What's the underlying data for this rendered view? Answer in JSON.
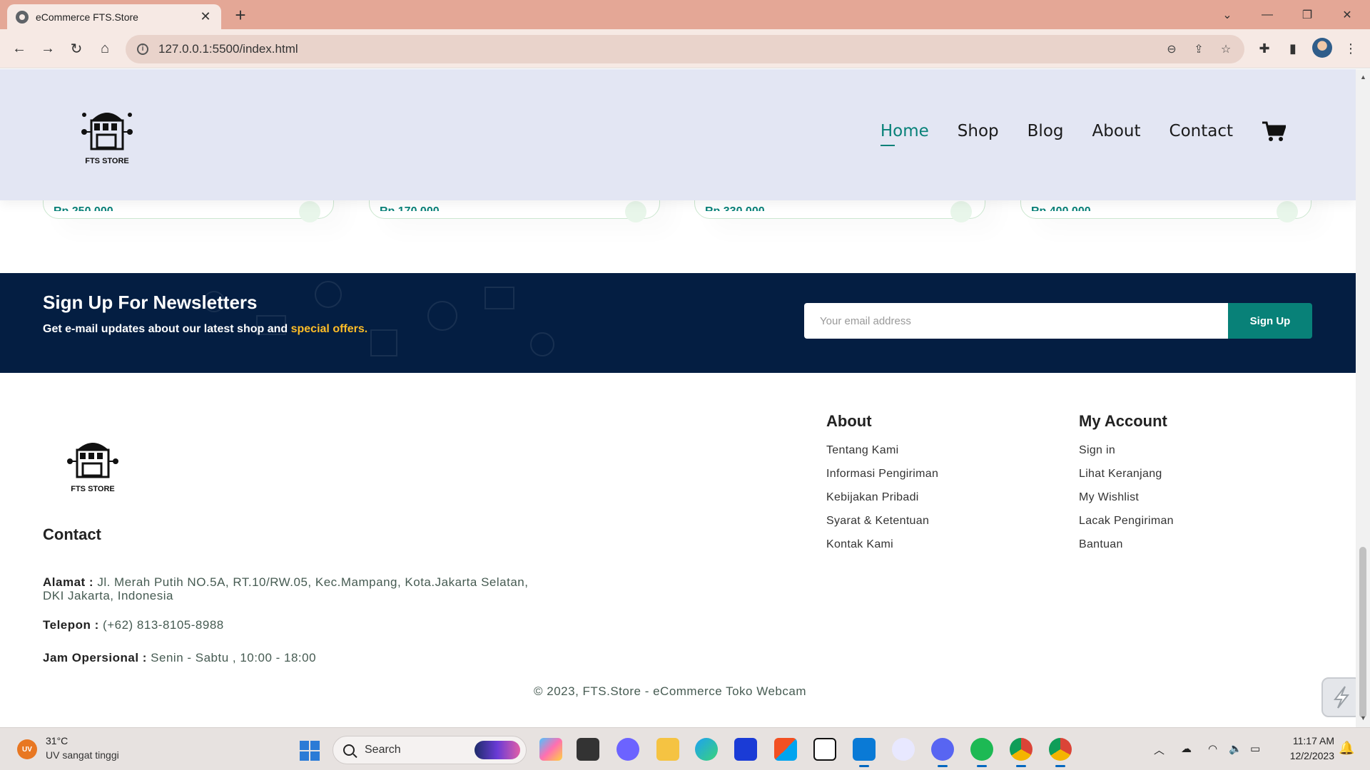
{
  "browser": {
    "tab_title": "eCommerce FTS.Store",
    "url": "127.0.0.1:5500/index.html"
  },
  "header": {
    "logo_text": "FTS STORE",
    "nav": [
      "Home",
      "Shop",
      "Blog",
      "About",
      "Contact"
    ],
    "active_nav": "Home"
  },
  "products": {
    "prices": [
      "Rp 250.000",
      "Rp 170.000",
      "Rp 330.000",
      "Rp 400.000"
    ]
  },
  "newsletter": {
    "title": "Sign Up For Newsletters",
    "subtitle_prefix": "Get e-mail updates about our latest shop and",
    "subtitle_highlight": "special offers.",
    "email_placeholder": "Your email address",
    "button_label": "Sign Up"
  },
  "footer": {
    "logo_text": "FTS STORE",
    "contact_title": "Contact",
    "address_label": "Alamat :",
    "address_line1": "Jl. Merah Putih NO.5A, RT.10/RW.05, Kec.Mampang, Kota.Jakarta Selatan,",
    "address_line2": "DKI Jakarta, Indonesia",
    "phone_label": "Telepon :",
    "phone_value": "(+62) 813-8105-8988",
    "hours_label": "Jam Opersional :",
    "hours_value": "Senin - Sabtu , 10:00 - 18:00",
    "about_title": "About",
    "about_links": [
      "Tentang Kami",
      "Informasi Pengiriman",
      "Kebijakan Pribadi",
      "Syarat & Ketentuan",
      "Kontak Kami"
    ],
    "account_title": "My Account",
    "account_links": [
      "Sign in",
      "Lihat Keranjang",
      "My Wishlist",
      "Lacak Pengiriman",
      "Bantuan"
    ],
    "copyright": "© 2023, FTS.Store - eCommerce Toko Webcam"
  },
  "taskbar": {
    "weather_badge": "UV",
    "weather_temp": "31°C",
    "weather_desc": "UV sangat tinggi",
    "search_label": "Search",
    "time": "11:17 AM",
    "date": "12/2/2023"
  },
  "colors": {
    "accent": "#088178",
    "header_bg": "#e3e6f3",
    "newsletter_bg": "#041e42",
    "highlight": "#ffbd27"
  }
}
